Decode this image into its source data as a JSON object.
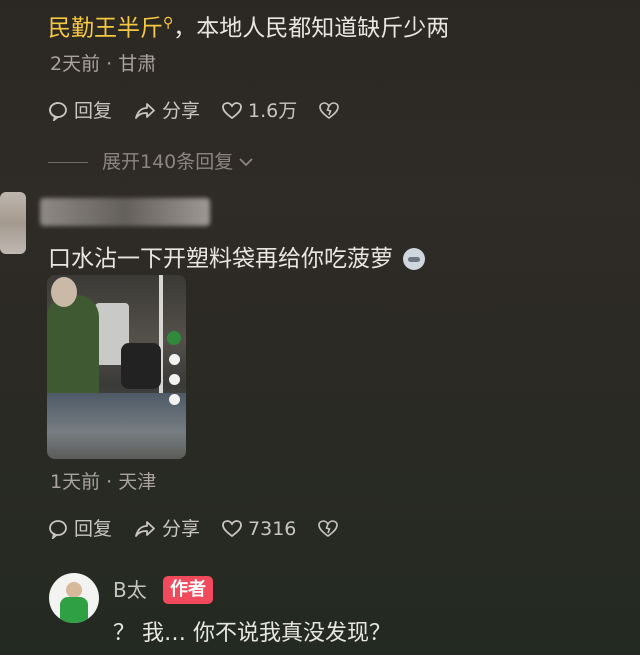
{
  "comment1": {
    "mention": "民勤王半斤",
    "text": "，本地人民都知道缺斤少两",
    "meta": "2天前 · 甘肃",
    "reply_label": "回复",
    "share_label": "分享",
    "likes": "1.6万",
    "expand_label": "展开140条回复"
  },
  "comment2": {
    "text": "口水沾一下开塑料袋再给你吃菠萝",
    "meta": "1天前 · 天津",
    "reply_label": "回复",
    "share_label": "分享",
    "likes": "7316"
  },
  "reply": {
    "name": "B太",
    "badge": "作者",
    "text": "？ 我… 你不说我真没发现？"
  },
  "colors": {
    "mention": "#f5c842",
    "author_badge": "#f04a5c"
  },
  "icons": [
    "search-icon",
    "comment-icon",
    "share-icon",
    "heart-icon",
    "dislike-heart-icon",
    "chevron-down-icon"
  ]
}
